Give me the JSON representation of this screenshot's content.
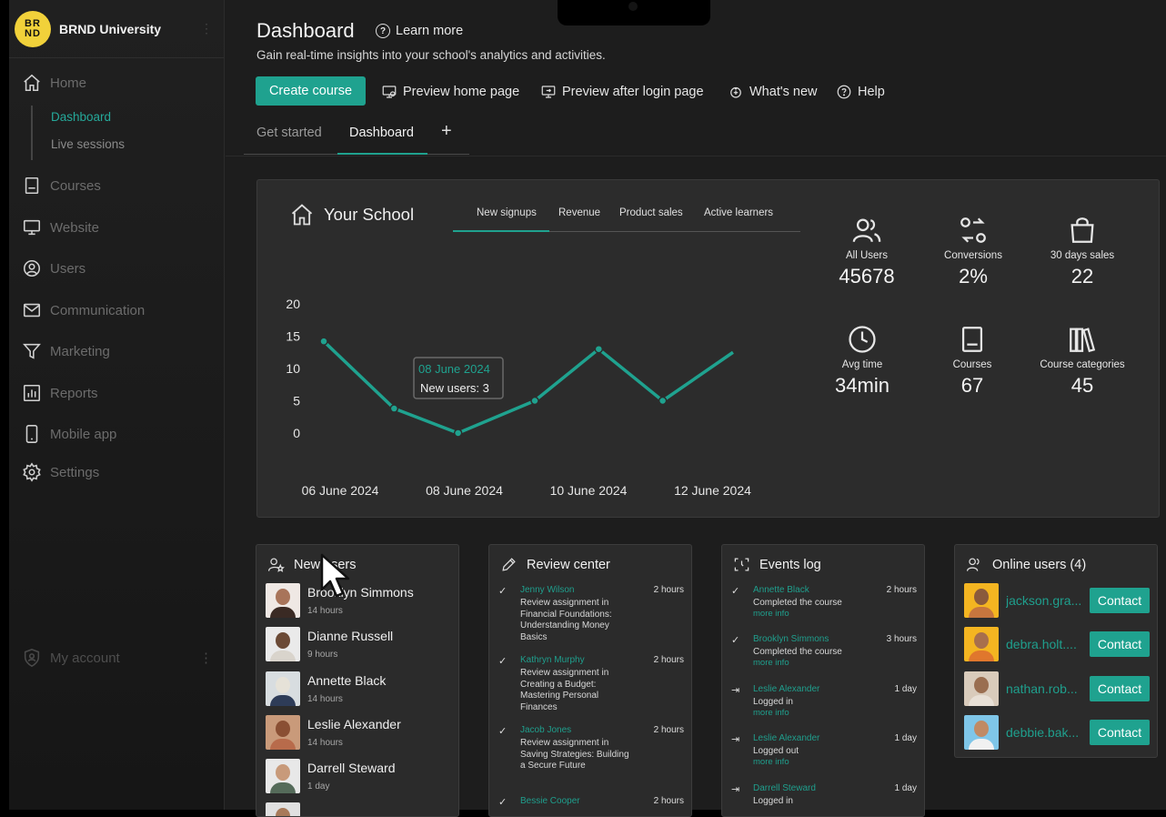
{
  "app": {
    "name": "BRND University",
    "logo_text": "BRND"
  },
  "sidebar": {
    "items": [
      {
        "label": "Home",
        "icon": "home-icon"
      },
      {
        "label": "Courses",
        "icon": "book-icon"
      },
      {
        "label": "Website",
        "icon": "monitor-icon"
      },
      {
        "label": "Users",
        "icon": "user-circle-icon"
      },
      {
        "label": "Communication",
        "icon": "mail-icon"
      },
      {
        "label": "Marketing",
        "icon": "funnel-icon"
      },
      {
        "label": "Reports",
        "icon": "bar-chart-icon"
      },
      {
        "label": "Mobile app",
        "icon": "phone-icon"
      },
      {
        "label": "Settings",
        "icon": "gear-icon"
      }
    ],
    "home_sub": [
      "Dashboard",
      "Live sessions"
    ],
    "account_label": "My account"
  },
  "header": {
    "title": "Dashboard",
    "learn_more": "Learn more",
    "subtitle": "Gain real-time insights into your school's analytics and activities.",
    "create_course": "Create course",
    "tools": [
      "Preview home page",
      "Preview after login page",
      "What's new",
      "Help"
    ],
    "tabs": [
      "Get started",
      "Dashboard"
    ]
  },
  "school": {
    "title": "Your School",
    "tabs": [
      "New signups",
      "Revenue",
      "Product sales",
      "Active learners"
    ],
    "active_tab": "New signups",
    "tooltip_date": "08 June 2024",
    "tooltip_value": "New users: 3",
    "stats": [
      {
        "label": "All Users",
        "value": "45678",
        "icon": "users-icon"
      },
      {
        "label": "Conversions",
        "value": "2%",
        "icon": "conversions-icon"
      },
      {
        "label": "30 days sales",
        "value": "22",
        "icon": "shopping-bag-icon"
      },
      {
        "label": "Avg time",
        "value": "34min",
        "icon": "clock-icon"
      },
      {
        "label": "Courses",
        "value": "67",
        "icon": "book-icon"
      },
      {
        "label": "Course categories",
        "value": "45",
        "icon": "library-icon"
      }
    ]
  },
  "chart_data": {
    "type": "line",
    "x_tick_labels": [
      "06 June 2024",
      "08 June 2024",
      "10 June 2024",
      "12 June 2024"
    ],
    "y_ticks": [
      0,
      5,
      10,
      15,
      20
    ],
    "ylim": [
      0,
      20
    ],
    "xlim": [
      0,
      6.6
    ],
    "series": [
      {
        "x": [
          0,
          1.1,
          2.1,
          3.3,
          4.3,
          5.3,
          6.4
        ],
        "values": [
          14.2,
          3.8,
          0,
          5,
          13,
          5,
          12.5
        ]
      }
    ],
    "color": "#1fa28f",
    "grid": false
  },
  "new_users": {
    "title": "New users",
    "users": [
      {
        "name": "Brooklyn Simmons",
        "time": "14 hours"
      },
      {
        "name": "Dianne Russell",
        "time": "9 hours"
      },
      {
        "name": "Annette Black",
        "time": "14 hours"
      },
      {
        "name": "Leslie Alexander",
        "time": "14 hours"
      },
      {
        "name": "Darrell Steward",
        "time": "1 day"
      }
    ]
  },
  "review_center": {
    "title": "Review center",
    "items": [
      {
        "who": "Jenny Wilson",
        "when": "2 hours",
        "text": "Review assignment in Financial Foundations: Understanding Money Basics"
      },
      {
        "who": "Kathryn Murphy",
        "when": "2 hours",
        "text": "Review assignment in Creating a Budget: Mastering Personal Finances"
      },
      {
        "who": "Jacob Jones",
        "when": "2 hours",
        "text": "Review assignment in Saving Strategies: Building a Secure Future"
      },
      {
        "who": "Bessie Cooper",
        "when": "2 hours",
        "text": ""
      }
    ]
  },
  "events_log": {
    "title": "Events log",
    "more": "more info",
    "items": [
      {
        "who": "Annette Black",
        "when": "2 hours",
        "text": "Completed the course"
      },
      {
        "who": "Brooklyn Simmons",
        "when": "3 hours",
        "text": "Completed the course"
      },
      {
        "who": "Leslie Alexander",
        "when": "1 day",
        "text": "Logged in"
      },
      {
        "who": "Leslie Alexander",
        "when": "1 day",
        "text": "Logged out"
      },
      {
        "who": "Darrell Steward",
        "when": "1 day",
        "text": "Logged in"
      }
    ]
  },
  "online_users": {
    "title": "Online users (4)",
    "contact": "Contact",
    "users": [
      "jackson.gra...",
      "debra.holt....",
      "nathan.rob...",
      "debbie.bak..."
    ]
  },
  "colors": {
    "accent": "#1fa28f",
    "background": "#1d1d1d",
    "panel": "#2c2c2c"
  }
}
